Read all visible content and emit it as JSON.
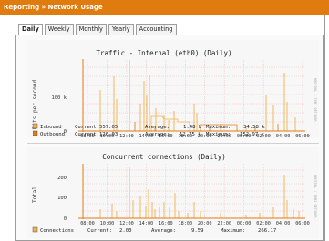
{
  "app": {
    "title": "Reporting » Network Usage"
  },
  "tabs": [
    {
      "label": "Daily",
      "active": true
    },
    {
      "label": "Weekly",
      "active": false
    },
    {
      "label": "Monthly",
      "active": false
    },
    {
      "label": "Yearly",
      "active": false
    },
    {
      "label": "Accounting",
      "active": false
    }
  ],
  "graph1": {
    "title": "Traffic - Internal (eth0) (Daily)",
    "ylabel": "Bits per second",
    "yticks": [
      "100 k",
      "0"
    ],
    "xticks": [
      "08:00",
      "10:00",
      "12:00",
      "14:00",
      "16:00",
      "18:00",
      "20:00",
      "22:00",
      "00:00",
      "02:00",
      "04:00",
      "06:00"
    ],
    "side_label": "RRDTOOL / TOBI OETIKER",
    "legend": [
      {
        "name": "Inbound",
        "color": "#f2b24a",
        "current": "557.05",
        "average": "1.48 k",
        "maximum": "34.58 k"
      },
      {
        "name": "Outbound",
        "color": "#e0801a",
        "current": "126.03",
        "average": "12.75 k",
        "maximum": "152.97 k"
      }
    ],
    "labels": {
      "current": "Current:",
      "average": "Average:",
      "maximum": "Maximum:"
    }
  },
  "graph2": {
    "title": "Concurrent connections (Daily)",
    "ylabel": "Total",
    "yticks": [
      "200",
      "100",
      "0"
    ],
    "xticks": [
      "08:00",
      "10:00",
      "12:00",
      "14:00",
      "16:00",
      "18:00",
      "20:00",
      "22:00",
      "00:00",
      "02:00",
      "04:00",
      "06:00"
    ],
    "side_label": "RRDTOOL / TOBI OETIKER",
    "legend": [
      {
        "name": "Connections",
        "color": "#f2b24a",
        "current": "2.00",
        "average": "9.59",
        "maximum": "266.17"
      }
    ],
    "labels": {
      "current": "Current:",
      "average": "Average:",
      "maximum": "Maximum:"
    }
  }
}
